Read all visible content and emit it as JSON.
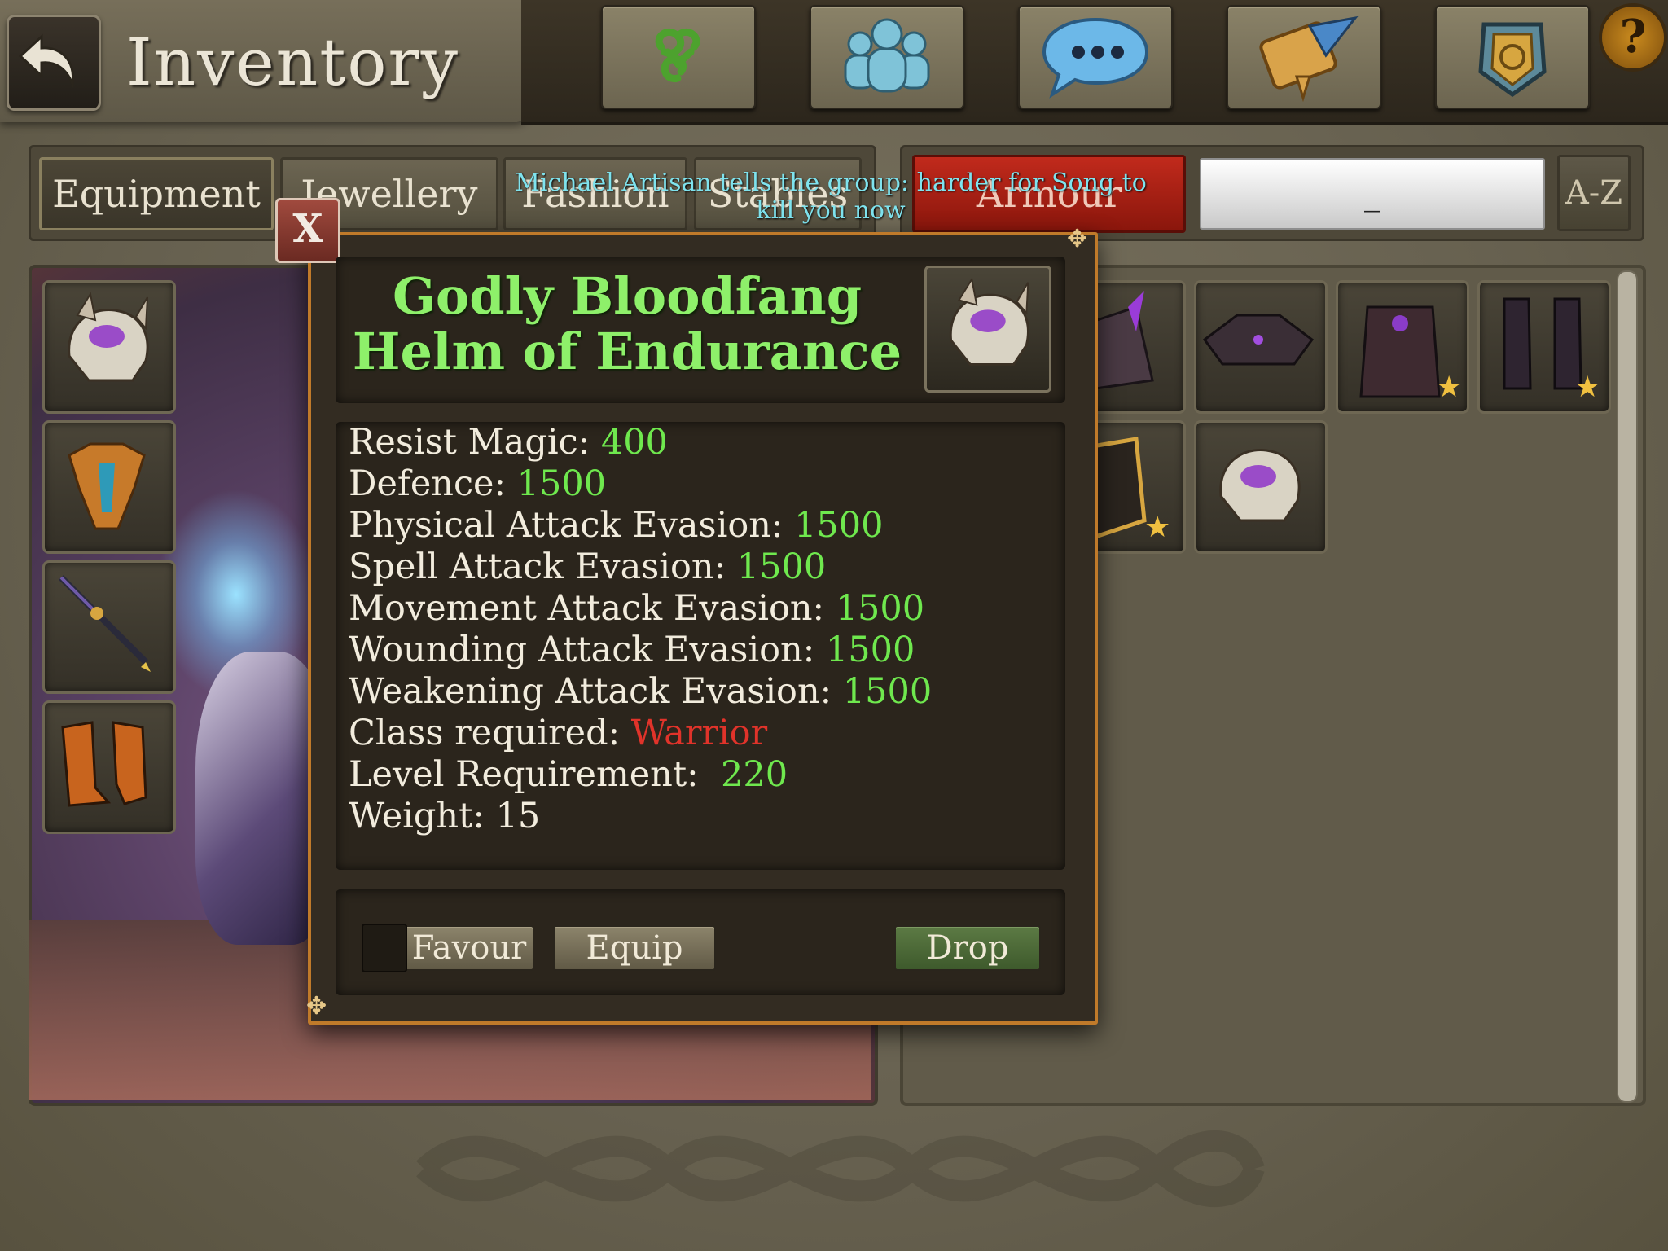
{
  "header": {
    "title": "Inventory"
  },
  "toolbar": {
    "buttons": [
      {
        "icon": "spiral-icon"
      },
      {
        "icon": "group-icon"
      },
      {
        "icon": "chat-icon"
      },
      {
        "icon": "quest-scroll-icon"
      },
      {
        "icon": "guild-shield-icon"
      }
    ],
    "help_label": "?"
  },
  "tabs": {
    "equipment": "Equipment",
    "jewellery": "Jewellery",
    "fashion": "Fashion",
    "stables": "Stables",
    "armour": "Armour"
  },
  "search": {
    "value": "_"
  },
  "sort_label": "A-Z",
  "chat_message": "Michael Artisan tells the group: harder for Song to kill you now",
  "popup": {
    "close_label": "X",
    "item_name": "Godly Bloodfang Helm of Endurance",
    "stats": [
      {
        "label": "Resist Magic:",
        "value": "400"
      },
      {
        "label": "Defence:",
        "value": "1500"
      },
      {
        "label": "Physical Attack Evasion:",
        "value": "1500"
      },
      {
        "label": "Spell Attack Evasion:",
        "value": "1500"
      },
      {
        "label": "Movement Attack Evasion:",
        "value": "1500"
      },
      {
        "label": "Wounding Attack Evasion:",
        "value": "1500"
      },
      {
        "label": "Weakening Attack Evasion:",
        "value": "1500"
      },
      {
        "label": "Class required:",
        "value": "Warrior"
      },
      {
        "label": "Level Requirement:",
        "value": "220"
      },
      {
        "label": "Weight:",
        "value": "15"
      }
    ],
    "actions": {
      "favour": "Favour",
      "equip": "Equip",
      "drop": "Drop"
    }
  },
  "colors": {
    "item_name": "#8ef06a",
    "stat_value": "#6fe84e",
    "class_required": "#e0332a",
    "chat": "#7fe3ee",
    "armour_tab": "#c12a1c"
  }
}
